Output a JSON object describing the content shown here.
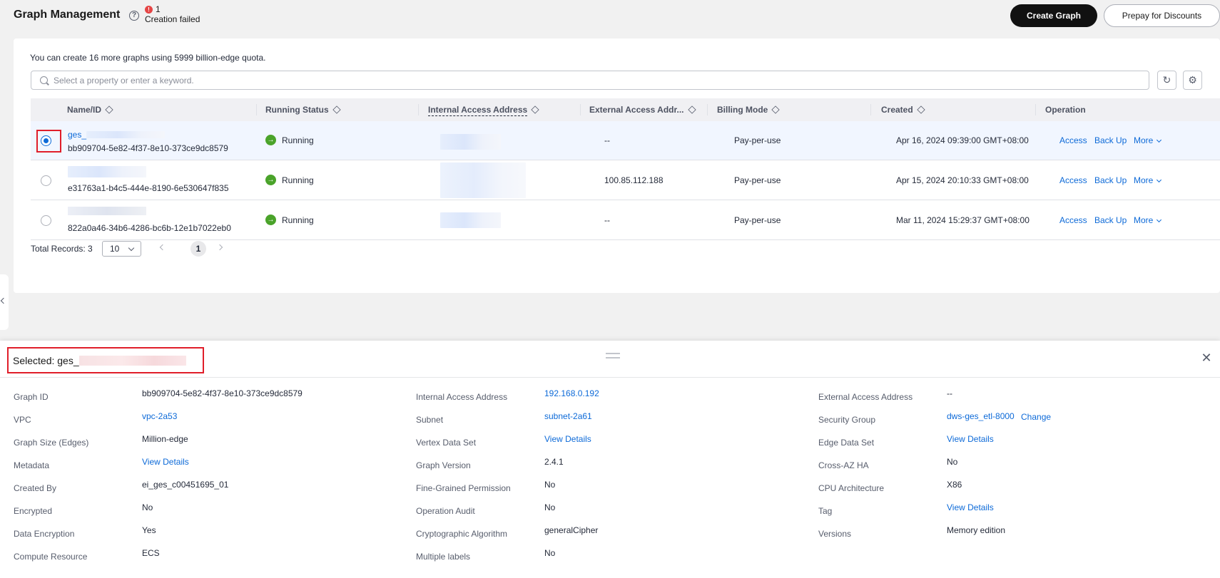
{
  "header": {
    "title": "Graph Management",
    "failed_count": "1",
    "failed_text": "Creation failed",
    "create_button": "Create Graph",
    "prepay_button": "Prepay for Discounts"
  },
  "list": {
    "quota_text": "You can create 16 more graphs using 5999 billion-edge quota.",
    "search_placeholder": "Select a property or enter a keyword.",
    "columns": [
      "Name/ID",
      "Running Status",
      "Internal Access Address",
      "External Access Addr...",
      "Billing Mode",
      "Created",
      "Operation"
    ],
    "rows": [
      {
        "name": "ges_",
        "id": "bb909704-5e82-4f37-8e10-373ce9dc8579",
        "status": "Running",
        "external": "--",
        "billing": "Pay-per-use",
        "created": "Apr 16, 2024 09:39:00 GMT+08:00",
        "selected": true
      },
      {
        "name": "",
        "id": "e31763a1-b4c5-444e-8190-6e530647f835",
        "status": "Running",
        "external": "100.85.112.188",
        "billing": "Pay-per-use",
        "created": "Apr 15, 2024 20:10:33 GMT+08:00",
        "selected": false
      },
      {
        "name": "",
        "id": "822a0a46-34b6-4286-bc6b-12e1b7022eb0",
        "status": "Running",
        "external": "--",
        "billing": "Pay-per-use",
        "created": "Mar 11, 2024 15:29:37 GMT+08:00",
        "selected": false
      }
    ],
    "ops": {
      "access": "Access",
      "backup": "Back Up",
      "more": "More"
    },
    "total_records": "Total Records: 3",
    "page_size": "10",
    "current_page": "1"
  },
  "detail": {
    "selected_prefix": "Selected: ges_",
    "col1": [
      {
        "label": "Graph ID",
        "value": "bb909704-5e82-4f37-8e10-373ce9dc8579",
        "link": false
      },
      {
        "label": "VPC",
        "value": "vpc-2a53",
        "link": true
      },
      {
        "label": "Graph Size (Edges)",
        "value": "Million-edge",
        "link": false
      },
      {
        "label": "Metadata",
        "value": "View Details",
        "link": true
      },
      {
        "label": "Created By",
        "value": "ei_ges_c00451695_01",
        "link": false
      },
      {
        "label": "Encrypted",
        "value": "No",
        "link": false
      },
      {
        "label": "Data Encryption",
        "value": "Yes",
        "link": false
      },
      {
        "label": "Compute Resource",
        "value": "ECS",
        "link": false
      }
    ],
    "col2": [
      {
        "label": "Internal Access Address",
        "value": "192.168.0.192",
        "link": true
      },
      {
        "label": "Subnet",
        "value": "subnet-2a61",
        "link": true
      },
      {
        "label": "Vertex Data Set",
        "value": "View Details",
        "link": true
      },
      {
        "label": "Graph Version",
        "value": "2.4.1",
        "link": false
      },
      {
        "label": "Fine-Grained Permission",
        "value": "No",
        "link": false
      },
      {
        "label": "Operation Audit",
        "value": "No",
        "link": false
      },
      {
        "label": "Cryptographic Algorithm",
        "value": "generalCipher",
        "link": false
      },
      {
        "label": "Multiple labels",
        "value": "No",
        "link": false
      }
    ],
    "col3": [
      {
        "label": "External Access Address",
        "value": "--",
        "link": false
      },
      {
        "label": "Security Group",
        "value": "dws-ges_etl-8000",
        "link": true,
        "extra": "Change"
      },
      {
        "label": "Edge Data Set",
        "value": "View Details",
        "link": true
      },
      {
        "label": "Cross-AZ HA",
        "value": "No",
        "link": false
      },
      {
        "label": "CPU Architecture",
        "value": "X86",
        "link": false
      },
      {
        "label": "Tag",
        "value": "View Details",
        "link": true
      },
      {
        "label": "Versions",
        "value": "Memory edition",
        "link": false
      }
    ]
  }
}
